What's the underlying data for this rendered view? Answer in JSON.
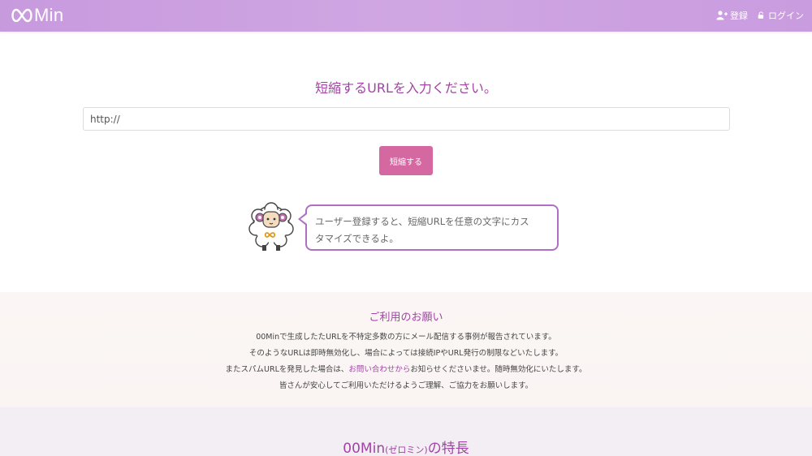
{
  "header": {
    "logo_text": "Min",
    "register_label": "登録",
    "login_label": "ログイン"
  },
  "main": {
    "title": "短縮するURLを入力ください。",
    "url_input": {
      "value": "",
      "placeholder": "http://"
    },
    "submit_label": "短縮する",
    "bubble_line1": "ユーザー登録すると、短縮URLを任意の文字にカス",
    "bubble_line2": "タマイズできるよ。"
  },
  "notice": {
    "title": "ご利用のお願い",
    "line1": "00Minで生成したたURLを不特定多数の方にメール配信する事例が報告されています。",
    "line2": "そのようなURLは即時無効化し、場合によっては接続IPやURL発行の制限などいたします。",
    "line3_before": "またスパムURLを発見した場合は、",
    "line3_link": "お問い合わせから",
    "line3_after": "お知らせくださいませ。随時無効化にいたします。",
    "line4": "皆さんが安心してご利用いただけるようご理解、ご協力をお願いします。"
  },
  "features": {
    "title_main": "00Min",
    "title_small": "(ゼロミン)",
    "title_end": "の特長"
  },
  "colors": {
    "header": "#cc9fe0",
    "accent": "#a243a5",
    "button": "#d567a1",
    "bubble_border": "#b06fc4"
  },
  "icons": {
    "logo": "infinity-icon",
    "register": "user-plus-icon",
    "login": "lock-icon"
  }
}
